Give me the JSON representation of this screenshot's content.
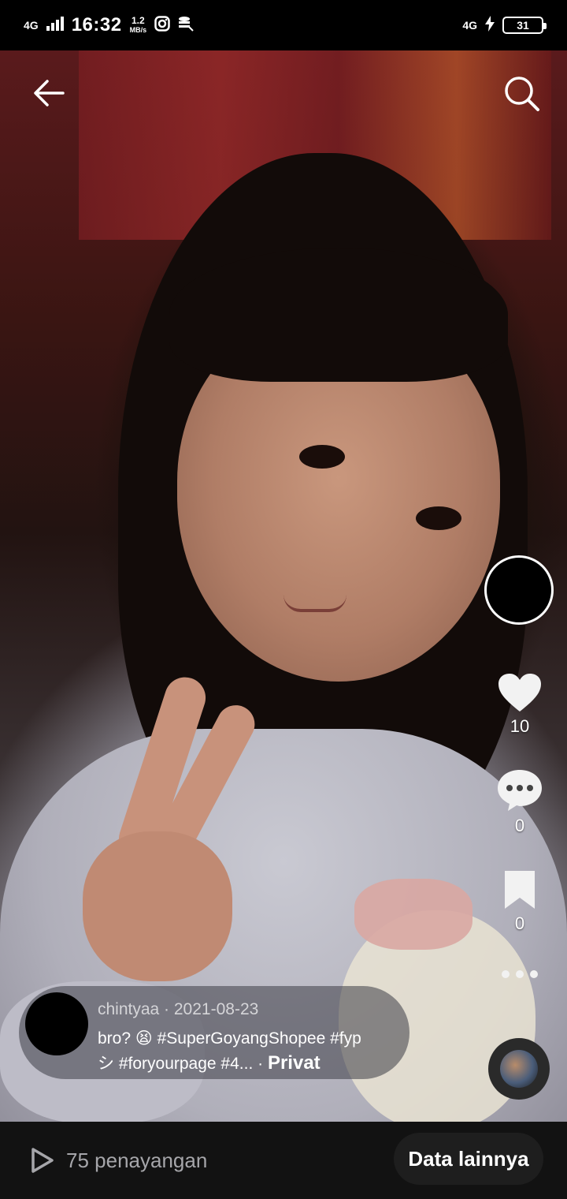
{
  "status_bar": {
    "signal_left": "4G",
    "time": "16:32",
    "net_speed_value": "1.2",
    "net_speed_unit": "MB/s",
    "signal_right": "4G",
    "battery": "31"
  },
  "actions": {
    "likes": "10",
    "comments": "0",
    "saves": "0"
  },
  "caption": {
    "author_date": "chintyaa · 2021-08-23",
    "line1": "bro? 😫 #SuperGoyangShopee #fyp",
    "line2": "シ #foryourpage #4... · ",
    "privacy": "Privat"
  },
  "bottom_bar": {
    "views": "75 penayangan",
    "more_data": "Data lainnya"
  }
}
